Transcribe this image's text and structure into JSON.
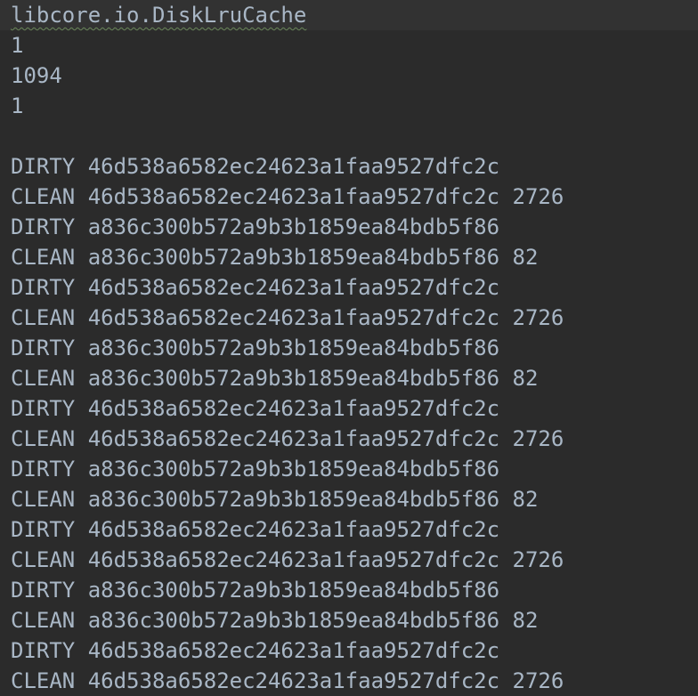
{
  "editor": {
    "lines": [
      "libcore.io.DiskLruCache",
      "1",
      "1094",
      "1",
      "",
      "DIRTY 46d538a6582ec24623a1faa9527dfc2c",
      "CLEAN 46d538a6582ec24623a1faa9527dfc2c 2726",
      "DIRTY a836c300b572a9b3b1859ea84bdb5f86",
      "CLEAN a836c300b572a9b3b1859ea84bdb5f86 82",
      "DIRTY 46d538a6582ec24623a1faa9527dfc2c",
      "CLEAN 46d538a6582ec24623a1faa9527dfc2c 2726",
      "DIRTY a836c300b572a9b3b1859ea84bdb5f86",
      "CLEAN a836c300b572a9b3b1859ea84bdb5f86 82",
      "DIRTY 46d538a6582ec24623a1faa9527dfc2c",
      "CLEAN 46d538a6582ec24623a1faa9527dfc2c 2726",
      "DIRTY a836c300b572a9b3b1859ea84bdb5f86",
      "CLEAN a836c300b572a9b3b1859ea84bdb5f86 82",
      "DIRTY 46d538a6582ec24623a1faa9527dfc2c",
      "CLEAN 46d538a6582ec24623a1faa9527dfc2c 2726",
      "DIRTY a836c300b572a9b3b1859ea84bdb5f86",
      "CLEAN a836c300b572a9b3b1859ea84bdb5f86 82",
      "DIRTY 46d538a6582ec24623a1faa9527dfc2c",
      "CLEAN 46d538a6582ec24623a1faa9527dfc2c 2726"
    ]
  },
  "colors": {
    "background": "#2b2b2b",
    "text": "#a9b7c6",
    "current_line": "#323232",
    "spellcheck_squiggle": "#6a8759"
  }
}
